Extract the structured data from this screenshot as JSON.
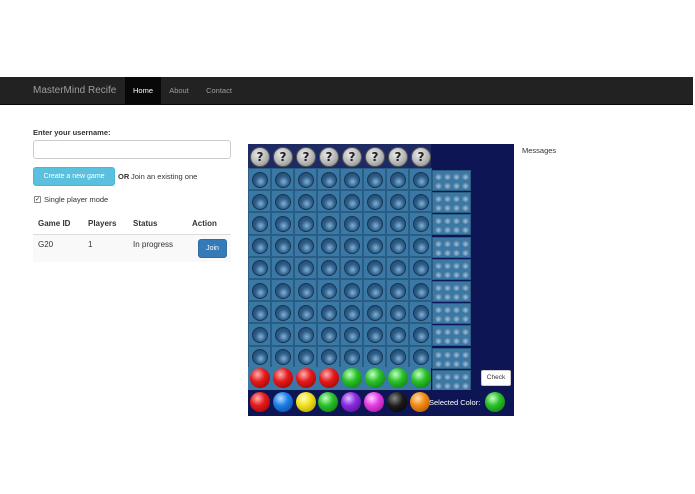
{
  "navbar": {
    "brand": "MasterMind Recife",
    "items": [
      {
        "label": "Home",
        "active": true
      },
      {
        "label": "About",
        "active": false
      },
      {
        "label": "Contact",
        "active": false
      }
    ]
  },
  "lobby": {
    "username_label": "Enter your username:",
    "username_value": "",
    "create_button": "Create a new game",
    "or_text": "OR",
    "join_text": "Join an existing one",
    "single_player_label": "Single player mode",
    "single_player_checked": true,
    "table": {
      "headers": [
        "Game ID",
        "Players",
        "Status",
        "Action"
      ],
      "rows": [
        {
          "game_id": "G20",
          "players": "1",
          "status": "In progress",
          "action": "Join"
        }
      ]
    }
  },
  "board": {
    "secret_code_symbol": "?",
    "secret_code_length": 8,
    "empty_rows": 9,
    "current_guess": [
      "red",
      "red",
      "red",
      "red",
      "green",
      "green",
      "green",
      "green"
    ],
    "palette": [
      "red",
      "blue",
      "yellow",
      "green",
      "purple",
      "pink",
      "black",
      "orange"
    ],
    "selected_color_label": "Selected Color:",
    "selected_color": "green",
    "check_button": "Check"
  },
  "messages": {
    "title": "Messages"
  },
  "colors": {
    "navbar_bg": "#222222",
    "info_button": "#5bc0de",
    "primary_button": "#337ab7",
    "board_bg": "#0d1554",
    "hole_cell": "#3a78a6"
  }
}
